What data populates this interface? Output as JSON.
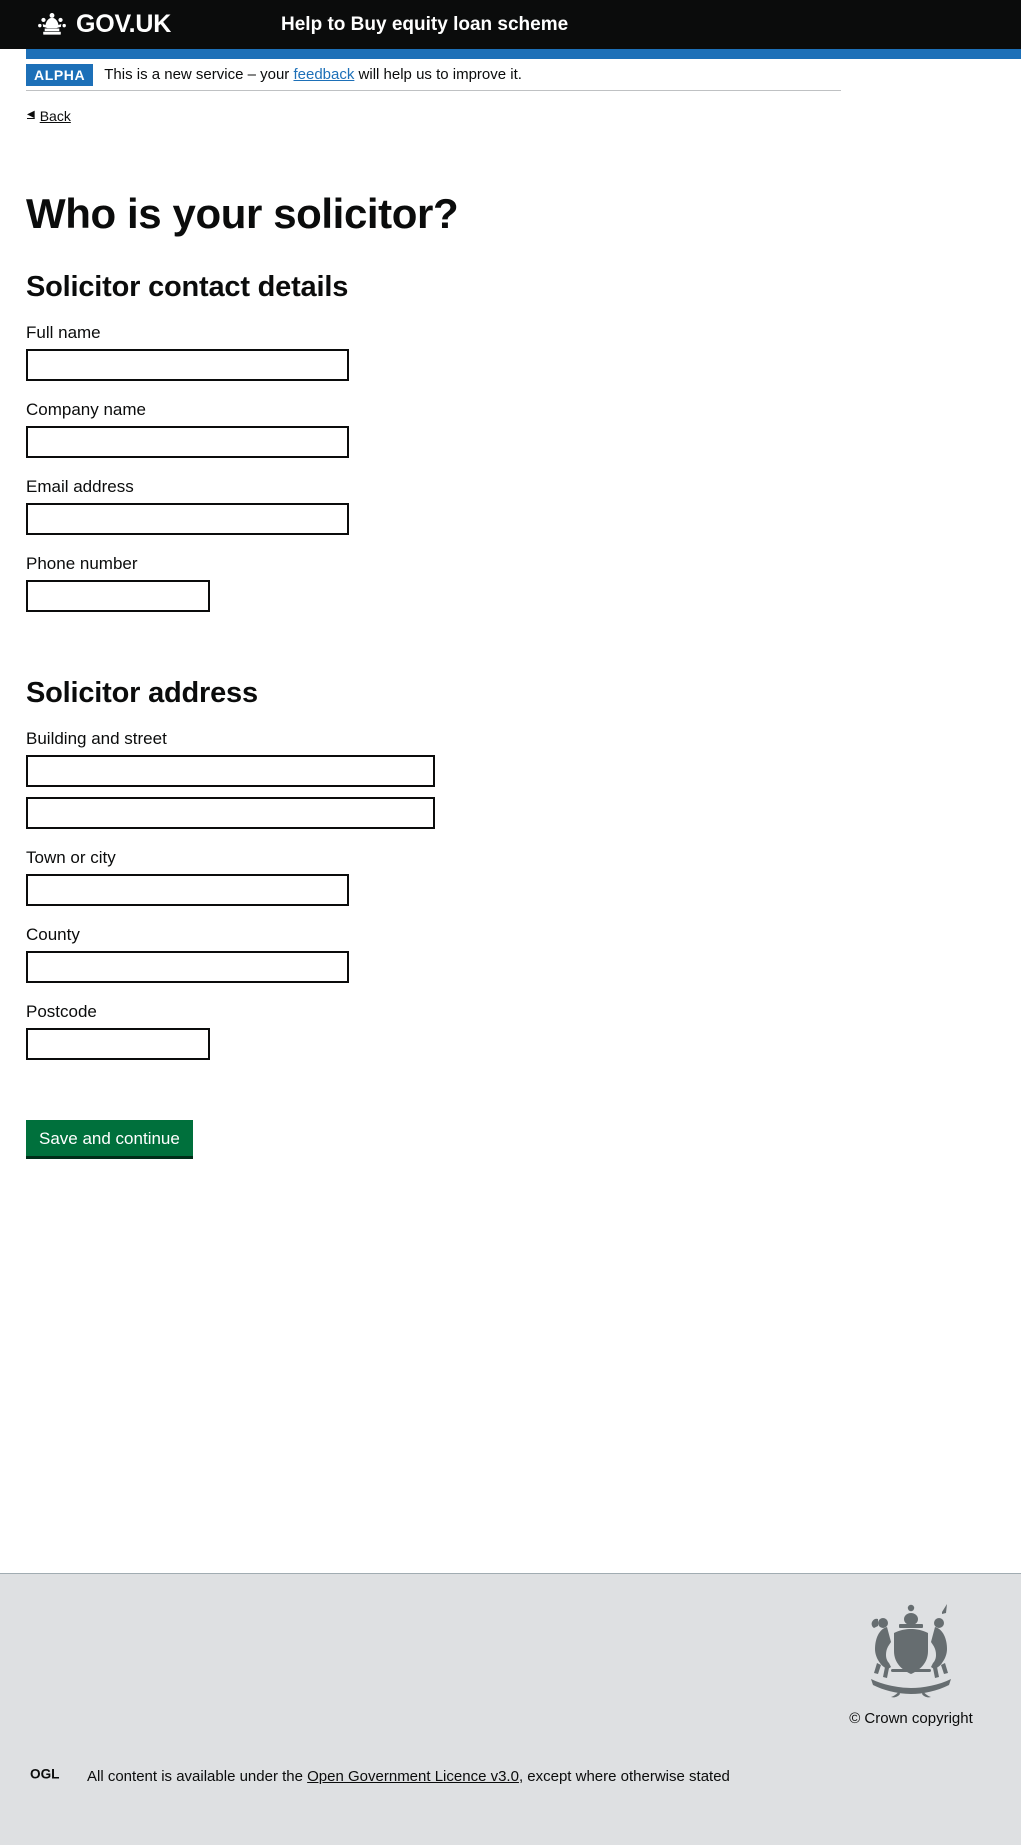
{
  "header": {
    "brand": "GOV.UK",
    "crown_icon": "crown-icon",
    "service_name": "Help to Buy equity loan scheme"
  },
  "phase_banner": {
    "tag": "ALPHA",
    "text_before": "This is a new service – your ",
    "link": "feedback",
    "text_after": " will help us to improve it."
  },
  "back_link": {
    "arrow": "◀",
    "label": "Back"
  },
  "main": {
    "page_title": "Who is your solicitor?",
    "contact_section": {
      "heading": "Solicitor contact details",
      "fields": [
        {
          "label": "Full name",
          "value": "",
          "placeholder": "",
          "name": "full-name-field",
          "width": "w-full"
        },
        {
          "label": "Company name",
          "value": "",
          "placeholder": "",
          "name": "company-name-field",
          "width": "w-full"
        },
        {
          "label": "Email address",
          "value": "",
          "placeholder": "",
          "name": "email-address-field",
          "width": "w-full"
        },
        {
          "label": "Phone number",
          "value": "",
          "placeholder": "",
          "name": "phone-number-field",
          "width": "w-short"
        }
      ]
    },
    "address_section": {
      "heading": "Solicitor address",
      "fields": [
        {
          "label": "Building and street",
          "value": "",
          "placeholder": "",
          "name": "building-and-street-field",
          "width": "w-wide"
        },
        {
          "label": "",
          "value": "",
          "placeholder": "",
          "name": "building-and-street-field-2",
          "width": "w-wide"
        },
        {
          "label": "Town or city",
          "value": "",
          "placeholder": "",
          "name": "town-or-city-field",
          "width": "w-full"
        },
        {
          "label": "County",
          "value": "",
          "placeholder": "",
          "name": "county-field",
          "width": "w-full"
        },
        {
          "label": "Postcode",
          "value": "",
          "placeholder": "",
          "name": "postcode-field",
          "width": "w-short"
        }
      ]
    },
    "submit_label": "Save and continue"
  },
  "footer": {
    "ogl_logo_label": "OGL",
    "licence_text_before": "All content is available under the ",
    "licence_link": "Open Government Licence v3.0",
    "licence_text_after": ", except where otherwise stated",
    "crown_copyright": "© Crown copyright",
    "crown_icon": "royal-coat-of-arms-icon"
  },
  "colors": {
    "header_black": "#0b0c0c",
    "accent_blue": "#1d70b8",
    "button_green": "#00703c",
    "button_green_shadow": "#002d18",
    "footer_grey": "#dee0e2",
    "border_black": "#0b0c0c"
  }
}
